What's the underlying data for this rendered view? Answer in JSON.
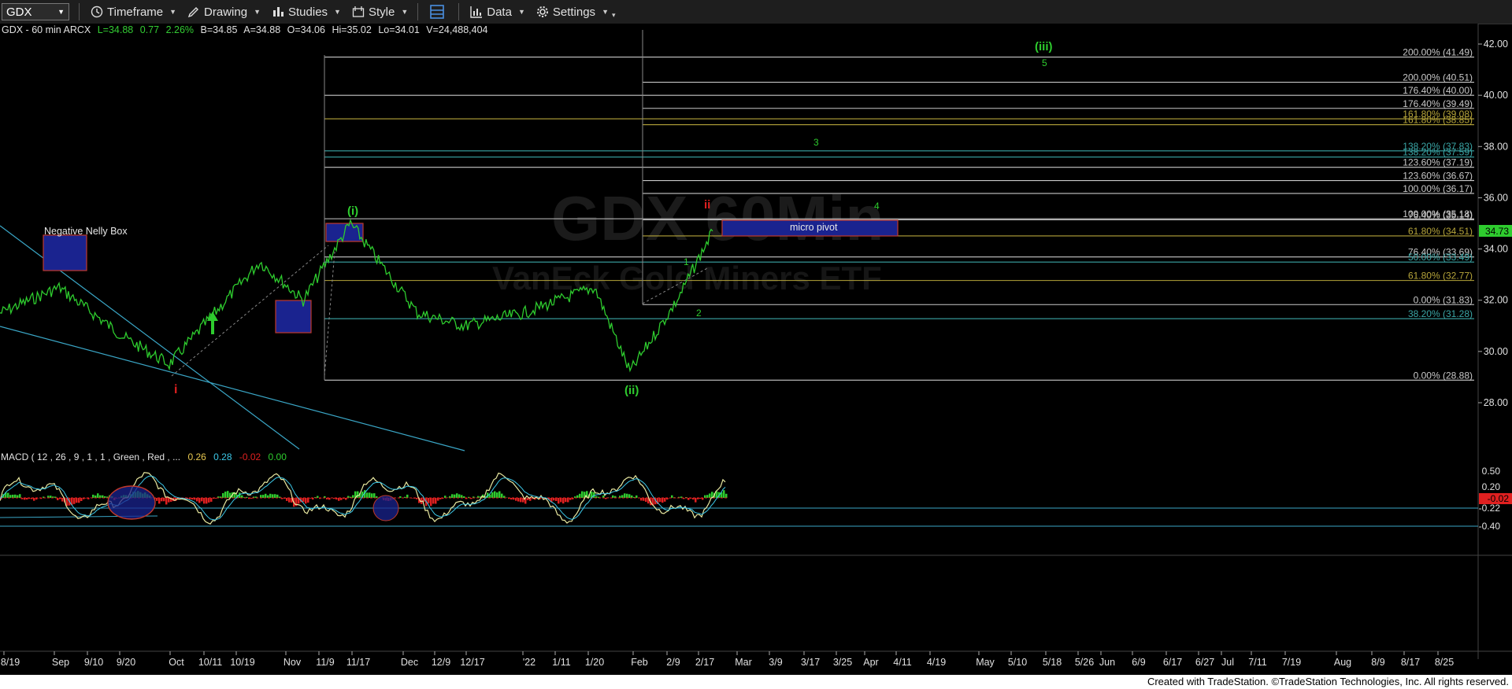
{
  "toolbar": {
    "symbol": "GDX",
    "timeframe": "Timeframe",
    "drawing": "Drawing",
    "studies": "Studies",
    "style": "Style",
    "data": "Data",
    "settings": "Settings"
  },
  "header": {
    "symbol_line": "GDX - 60 min ARCX",
    "last": "L=34.88",
    "change": "0.77",
    "pct": "2.26%",
    "bid": "B=34.85",
    "ask": "A=34.88",
    "open": "O=34.06",
    "high": "Hi=35.02",
    "low": "Lo=34.01",
    "volume": "V=24,488,404"
  },
  "watermark": {
    "line1": "GDX 60Min",
    "line2": "VanEck Gold Miners ETF"
  },
  "annotations": {
    "nelly_box": "Negative Nelly Box",
    "micro_pivot": "micro pivot",
    "wave_i": "i",
    "wave_paren_i": "(i)",
    "wave_ii": "ii",
    "wave_paren_ii": "(ii)",
    "wave_paren_iii": "(iii)",
    "w1": "1",
    "w2": "2",
    "w3": "3",
    "w4": "4",
    "w5": "5"
  },
  "fib_levels": [
    {
      "label": "200.00% (41.49)",
      "price": 41.49,
      "color": "#c8c8c8"
    },
    {
      "label": "200.00% (40.51)",
      "price": 40.51,
      "color": "#c8c8c8"
    },
    {
      "label": "176.40% (40.00)",
      "price": 40.0,
      "color": "#c8c8c8"
    },
    {
      "label": "176.40% (39.49)",
      "price": 39.49,
      "color": "#c8c8c8"
    },
    {
      "label": "161.80% (39.08)",
      "price": 39.08,
      "color": "#b5a43a"
    },
    {
      "label": "161.80% (38.85)",
      "price": 38.85,
      "color": "#b5a43a"
    },
    {
      "label": "138.20% (37.83)",
      "price": 37.83,
      "color": "#3aa6a6"
    },
    {
      "label": "138.20% (37.59)",
      "price": 37.59,
      "color": "#3aa6a6"
    },
    {
      "label": "123.60% (37.19)",
      "price": 37.19,
      "color": "#c8c8c8"
    },
    {
      "label": "123.60% (36.67)",
      "price": 36.67,
      "color": "#c8c8c8"
    },
    {
      "label": "100.00% (36.17)",
      "price": 36.17,
      "color": "#c8c8c8"
    },
    {
      "label": "100.00% (35.18)",
      "price": 35.18,
      "color": "#c8c8c8"
    },
    {
      "label": "76.40% (35.14)",
      "price": 35.14,
      "color": "#c8c8c8"
    },
    {
      "label": "61.80% (34.51)",
      "price": 34.51,
      "color": "#b5a43a"
    },
    {
      "label": "76.40% (33.69)",
      "price": 33.69,
      "color": "#c8c8c8"
    },
    {
      "label": "50.00% (33.49)",
      "price": 33.49,
      "color": "#3aa6a6"
    },
    {
      "label": "61.80% (32.77)",
      "price": 32.77,
      "color": "#b5a43a"
    },
    {
      "label": "0.00% (31.83)",
      "price": 31.83,
      "color": "#c8c8c8"
    },
    {
      "label": "38.20% (31.28)",
      "price": 31.28,
      "color": "#3aa6a6"
    },
    {
      "label": "0.00% (28.88)",
      "price": 28.88,
      "color": "#c8c8c8"
    }
  ],
  "price_axis": {
    "ticks": [
      "42.00",
      "40.00",
      "38.00",
      "36.00",
      "34.00",
      "32.00",
      "30.00",
      "28.00"
    ],
    "last_price": "34.73"
  },
  "macd": {
    "label": "MACD ( 12 , 26 , 9 , 1 , 1 , Green , Red , ...",
    "v1": "0.26",
    "v2": "0.28",
    "v3": "-0.02",
    "v4": "0.00",
    "axis_ticks": [
      "0.50",
      "0.20",
      "-0.22",
      "-0.40"
    ],
    "current": "-0.02"
  },
  "time_axis": [
    "8/19",
    "Sep",
    "9/10",
    "9/20",
    "Oct",
    "10/11",
    "10/19",
    "Nov",
    "11/9",
    "11/17",
    "Dec",
    "12/9",
    "12/17",
    "'22",
    "1/11",
    "1/20",
    "Feb",
    "2/9",
    "2/17",
    "Mar",
    "3/9",
    "3/17",
    "3/25",
    "Apr",
    "4/11",
    "4/19",
    "May",
    "5/10",
    "5/18",
    "5/26",
    "Jun",
    "6/9",
    "6/17",
    "6/27",
    "Jul",
    "7/11",
    "7/19",
    "Aug",
    "8/9",
    "8/17",
    "8/25"
  ],
  "footer": "Created with TradeStation. ©TradeStation Technologies, Inc. All rights reserved.",
  "chart_data": {
    "type": "line",
    "title": "GDX - 60 min ARCX",
    "x": [
      "8/19",
      "Sep",
      "9/20",
      "Oct",
      "10/19",
      "Nov",
      "11/17",
      "Dec",
      "12/17",
      "'22",
      "1/20",
      "Feb",
      "2/9",
      "2/17"
    ],
    "series": [
      {
        "name": "GDX",
        "values": [
          31.5,
          32.5,
          30.5,
          29.5,
          33.5,
          32.0,
          35.0,
          31.5,
          31.0,
          31.5,
          32.5,
          29.2,
          32.0,
          34.7
        ]
      }
    ],
    "ylim": [
      27.0,
      42.5
    ],
    "xlabel": "",
    "ylabel": ""
  }
}
